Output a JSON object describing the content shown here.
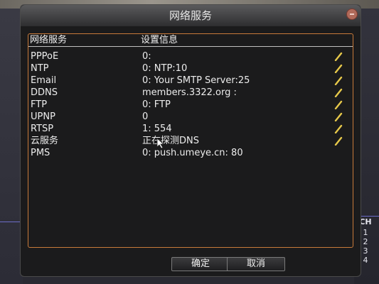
{
  "dialog": {
    "title": "网络服务",
    "columns": {
      "service": "网络服务",
      "config": "设置信息"
    },
    "rows": [
      {
        "name": "PPPoE",
        "info": "0:"
      },
      {
        "name": "NTP",
        "info": "0: NTP:10"
      },
      {
        "name": "Email",
        "info": "0: Your SMTP Server:25"
      },
      {
        "name": "DDNS",
        "info": "members.3322.org :"
      },
      {
        "name": "FTP",
        "info": "0: FTP"
      },
      {
        "name": "UPNP",
        "info": "0"
      },
      {
        "name": "RTSP",
        "info": "1: 554"
      },
      {
        "name": "云服务",
        "info": "正在探测DNS"
      },
      {
        "name": "PMS",
        "info": "0: push.umeye.cn: 80"
      }
    ],
    "buttons": {
      "ok": "确定",
      "cancel": "取消"
    }
  },
  "channel_panel": {
    "label": "CH",
    "channels": [
      "1",
      "2",
      "3",
      "4"
    ]
  },
  "colors": {
    "panel_border": "#c87a3a",
    "edit_icon": "#e6c84a"
  }
}
